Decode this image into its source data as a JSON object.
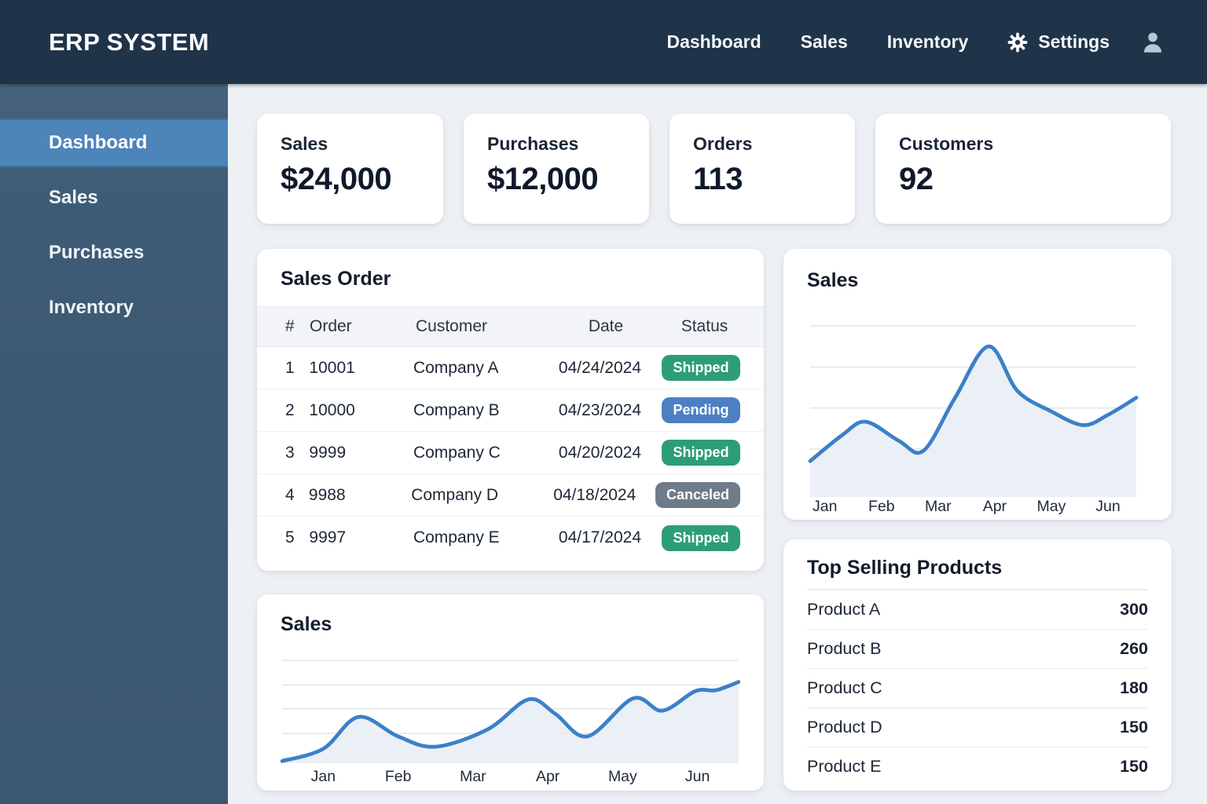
{
  "app": {
    "title": "ERP SYSTEM"
  },
  "navbar": {
    "items": [
      "Dashboard",
      "Sales",
      "Inventory",
      "Settings"
    ],
    "settings_icon": "gear-icon",
    "user_icon": "user-avatar-icon"
  },
  "sidebar": {
    "items": [
      {
        "label": "Dashboard",
        "active": true
      },
      {
        "label": "Sales",
        "active": false
      },
      {
        "label": "Purchases",
        "active": false
      },
      {
        "label": "Inventory",
        "active": false
      }
    ]
  },
  "stats": [
    {
      "label": "Sales",
      "value": "$24,000"
    },
    {
      "label": "Purchases",
      "value": "$12,000"
    },
    {
      "label": "Orders",
      "value": "113"
    },
    {
      "label": "Customers",
      "value": "92"
    }
  ],
  "sales_order": {
    "title": "Sales Order",
    "columns": [
      "#",
      "Order",
      "Customer",
      "Date",
      "Status"
    ],
    "rows": [
      {
        "num": "1",
        "order": "10001",
        "customer": "Company A",
        "date": "04/24/2024",
        "status": "Shipped"
      },
      {
        "num": "2",
        "order": "10000",
        "customer": "Company B",
        "date": "04/23/2024",
        "status": "Pending"
      },
      {
        "num": "3",
        "order": "9999",
        "customer": "Company C",
        "date": "04/20/2024",
        "status": "Shipped"
      },
      {
        "num": "4",
        "order": "9988",
        "customer": "Company D",
        "date": "04/18/2024",
        "status": "Canceled"
      },
      {
        "num": "5",
        "order": "9997",
        "customer": "Company E",
        "date": "04/17/2024",
        "status": "Shipped"
      }
    ],
    "status_colors": {
      "Shipped": "#2d9d78",
      "Pending": "#4c80c3",
      "Canceled": "#6e7b89"
    }
  },
  "chart_data": [
    {
      "type": "area",
      "title": "Sales",
      "x_labels": [
        "Jan",
        "Feb",
        "Mar",
        "Apr",
        "May",
        "Jun"
      ],
      "points": [
        [
          -0.26,
          21
        ],
        [
          0.3,
          36
        ],
        [
          0.72,
          44
        ],
        [
          1.3,
          33
        ],
        [
          1.74,
          27
        ],
        [
          2.3,
          58
        ],
        [
          2.89,
          88
        ],
        [
          3.4,
          62
        ],
        [
          4.0,
          50
        ],
        [
          4.56,
          42
        ],
        [
          5.0,
          48
        ],
        [
          5.5,
          58
        ]
      ],
      "ylim": [
        0,
        100
      ],
      "grid_values": [
        100,
        76,
        52,
        28
      ],
      "line_color": "#3c80c8",
      "fill_color": "#e9eef5",
      "grid": true,
      "legend": "none"
    },
    {
      "type": "area",
      "title": "Sales",
      "x_labels": [
        "Jan",
        "Feb",
        "Mar",
        "Apr",
        "May",
        "Jun"
      ],
      "points": [
        [
          -0.55,
          2
        ],
        [
          0.0,
          14
        ],
        [
          0.47,
          45
        ],
        [
          1.0,
          26
        ],
        [
          1.5,
          16
        ],
        [
          2.2,
          33
        ],
        [
          2.74,
          62
        ],
        [
          3.1,
          48
        ],
        [
          3.53,
          26
        ],
        [
          4.14,
          63
        ],
        [
          4.53,
          51
        ],
        [
          4.97,
          70
        ],
        [
          5.25,
          71
        ],
        [
          5.55,
          79
        ]
      ],
      "ylim": [
        0,
        100
      ],
      "grid_values": [
        100,
        76,
        53,
        29,
        5
      ],
      "line_color": "#3c80c8",
      "fill_color": "#e9eef5",
      "grid": true,
      "legend": "none"
    }
  ],
  "top_products": {
    "title": "Top Selling Products",
    "items": [
      {
        "name": "Product A",
        "value": "300"
      },
      {
        "name": "Product B",
        "value": "260"
      },
      {
        "name": "Product C",
        "value": "180"
      },
      {
        "name": "Product D",
        "value": "150"
      },
      {
        "name": "Product E",
        "value": "150"
      }
    ]
  },
  "colors": {
    "topbar_bg": "#1f3449",
    "sidebar_bg": "#3e5b75",
    "sidebar_active_bg": "#4d84ba",
    "main_bg": "#edf0f4",
    "chart_line": "#3c80c8",
    "chart_fill": "#e9eef5"
  }
}
